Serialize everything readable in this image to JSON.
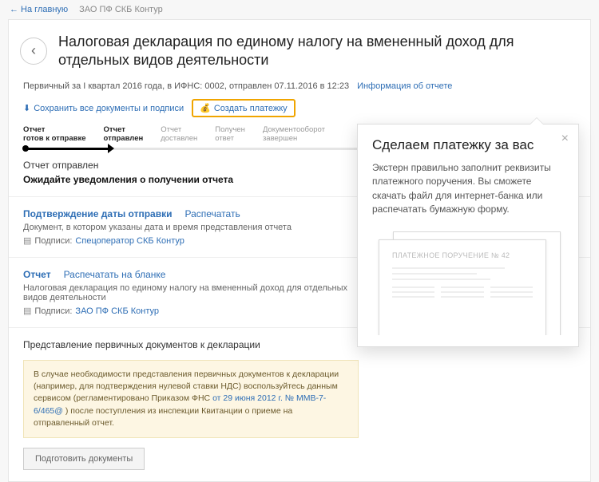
{
  "nav": {
    "home": "← На главную",
    "org": "ЗАО ПФ СКБ Контур"
  },
  "header": {
    "title": "Налоговая декларация по единому налогу на вмененный доход для отдельных видов деятельности"
  },
  "meta": {
    "text": "Первичный за I квартал 2016 года, в ИФНС: 0002, отправлен 07.11.2016 в 12:23",
    "info_link": "Информация об отчете",
    "save_link": "Сохранить все документы и подписи",
    "create_btn": "Создать платежку"
  },
  "steps": {
    "s1": "Отчет\nготов к отправке",
    "s2": "Отчет\nотправлен",
    "s3": "Отчет\nдоставлен",
    "s4": "Получен\nответ",
    "s5": "Документооборот\nзавершен"
  },
  "status": {
    "line1": "Отчет отправлен",
    "line2": "Ожидайте уведомления о получении отчета"
  },
  "sec1": {
    "title": "Подтверждение даты отправки",
    "action": "Распечатать",
    "desc": "Документ, в котором указаны дата и время представления отчета",
    "sig_label": "Подписи:",
    "sig_org": "Спецоператор СКБ Контур"
  },
  "sec2": {
    "title": "Отчет",
    "action": "Распечатать на бланке",
    "desc": "Налоговая декларация по единому налогу на вмененный доход для отдельных видов деятельности",
    "sig_label": "Подписи:",
    "sig_org": "ЗАО ПФ СКБ Контур"
  },
  "repr": {
    "title": "Представление первичных документов к декларации",
    "notice_pre": "В случае необходимости представления первичных документов к декларации (например, для подтверждения нулевой ставки НДС) воспользуйтесь данным сервисом (регламентировано Приказом ФНС ",
    "notice_link": "от 29 июня 2012 г. № ММВ-7-6/465@",
    "notice_post": ") после поступления из инспекции Квитанции о приеме на отправленный отчет.",
    "button": "Подготовить документы"
  },
  "popover": {
    "title": "Сделаем платежку за вас",
    "body": "Экстерн правильно заполнит реквизиты платежного поручения. Вы сможете скачать файл для интернет-банка или распечатать бумажную форму.",
    "doc_label": "ПЛАТЕЖНОЕ ПОРУЧЕНИЕ № 42"
  }
}
